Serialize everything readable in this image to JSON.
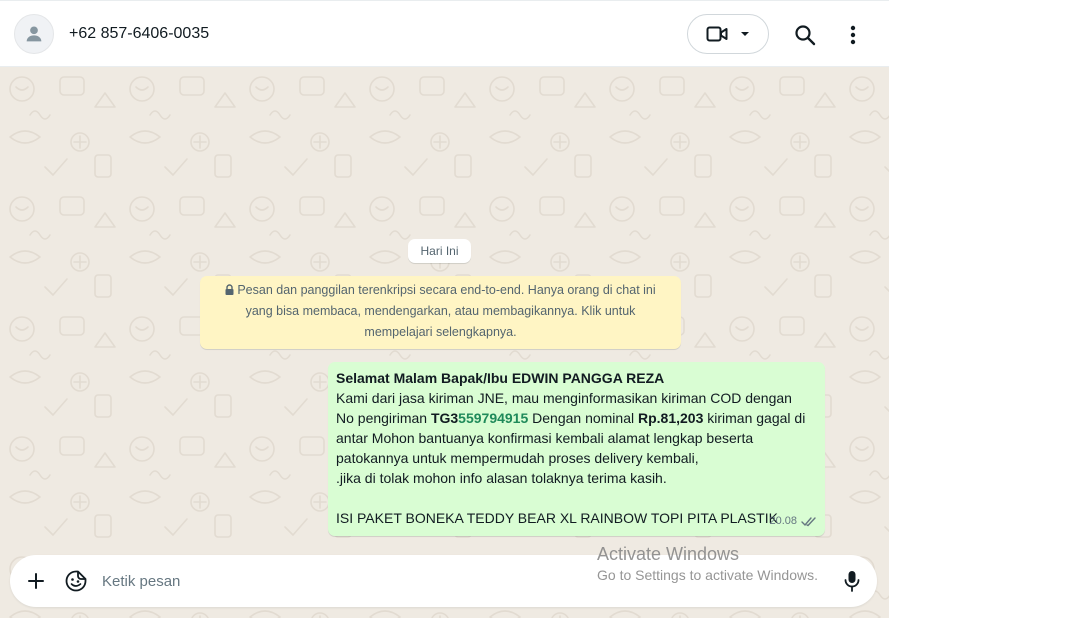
{
  "header": {
    "contact_name": "+62 857-6406-0035",
    "icons": {
      "avatar": "person-icon",
      "video": "video-camera-icon",
      "dropdown": "chevron-down-icon",
      "search": "search-icon",
      "menu": "more-vertical-icon"
    }
  },
  "chat": {
    "date_chip": "Hari Ini",
    "encryption_notice": {
      "line1": "Pesan dan panggilan terenkripsi secara end-to-end. Hanya orang di chat ini",
      "line2": "yang bisa membaca, mendengarkan, atau membagikannya. Klik untuk",
      "line3": "mempelajari selengkapnya.",
      "icon": "lock-icon"
    },
    "message": {
      "line1": "Selamat Malam Bapak/Ibu EDWIN PANGGA REZA",
      "line2": "Kami dari jasa kiriman JNE, mau menginformasikan kiriman COD dengan",
      "line3_a": "No pengiriman ",
      "line3_prefix": "TG3",
      "line3_link": "559794915",
      "line3_b": " Dengan nominal ",
      "line3_amount": "Rp.81,203",
      "line3_c": " kiriman gagal di",
      "line4": "antar Mohon bantuanya konfirmasi kembali alamat lengkap beserta",
      "line5": "patokannya untuk mempermudah proses delivery kembali,",
      "line6": " .jika di tolak mohon info alasan tolaknya terima kasih.",
      "line7": "",
      "line8": "ISI PAKET BONEKA TEDDY BEAR XL RAINBOW TOPI PITA PLASTIK",
      "time": "20.08",
      "status_icon": "double-check-icon"
    }
  },
  "input_bar": {
    "placeholder": "Ketik pesan",
    "value": "",
    "icons": {
      "add": "plus-icon",
      "sticker": "sticker-icon",
      "mic": "microphone-icon"
    }
  },
  "watermark": {
    "title": "Activate Windows",
    "subtitle": "Go to Settings to activate Windows."
  },
  "colors": {
    "chat_bg": "#efeae2",
    "bubble_out": "#d9fdd3",
    "notice_bg": "#fff5c4",
    "icon": "#54656f"
  }
}
